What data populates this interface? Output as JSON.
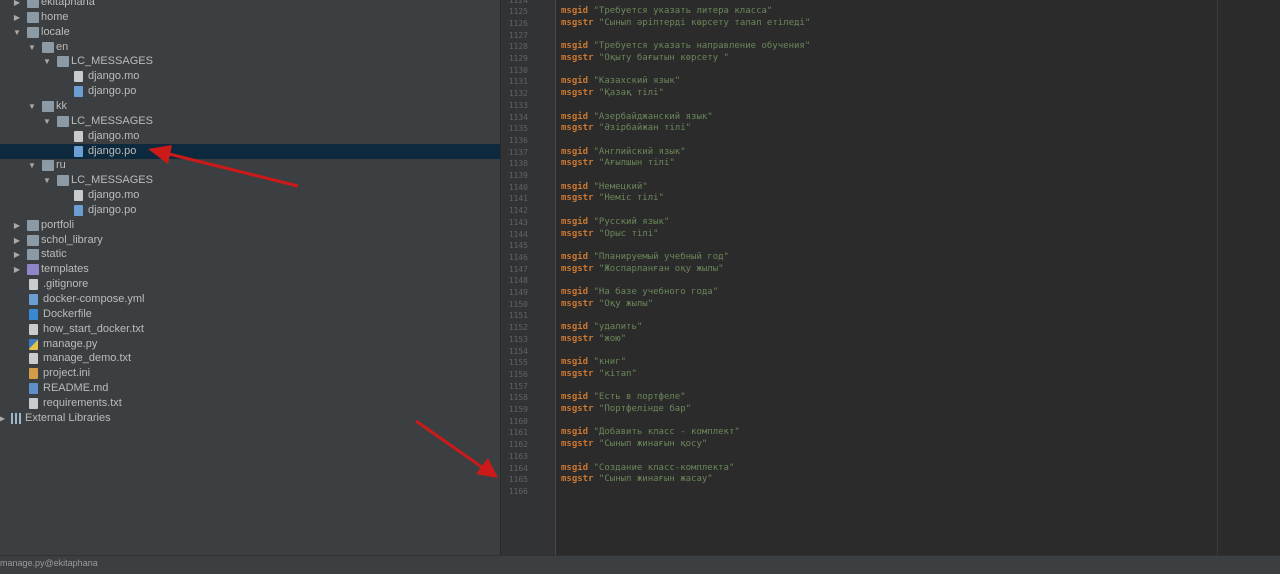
{
  "tree": [
    {
      "label": "ekitaphana",
      "type": "folder",
      "depth": 1,
      "expanded": false
    },
    {
      "label": "home",
      "type": "folder",
      "depth": 1,
      "expanded": false
    },
    {
      "label": "locale",
      "type": "folder",
      "depth": 1,
      "expanded": true
    },
    {
      "label": "en",
      "type": "folder",
      "depth": 2,
      "expanded": true
    },
    {
      "label": "LC_MESSAGES",
      "type": "folder",
      "depth": 3,
      "expanded": true
    },
    {
      "label": "django.mo",
      "type": "file",
      "ext": "mo",
      "depth": 4
    },
    {
      "label": "django.po",
      "type": "file",
      "ext": "po",
      "depth": 4
    },
    {
      "label": "kk",
      "type": "folder",
      "depth": 2,
      "expanded": true
    },
    {
      "label": "LC_MESSAGES",
      "type": "folder",
      "depth": 3,
      "expanded": true
    },
    {
      "label": "django.mo",
      "type": "file",
      "ext": "mo",
      "depth": 4
    },
    {
      "label": "django.po",
      "type": "file",
      "ext": "po",
      "depth": 4,
      "selected": true
    },
    {
      "label": "ru",
      "type": "folder",
      "depth": 2,
      "expanded": true
    },
    {
      "label": "LC_MESSAGES",
      "type": "folder",
      "depth": 3,
      "expanded": true
    },
    {
      "label": "django.mo",
      "type": "file",
      "ext": "mo",
      "depth": 4
    },
    {
      "label": "django.po",
      "type": "file",
      "ext": "po",
      "depth": 4
    },
    {
      "label": "portfoli",
      "type": "folder",
      "depth": 1,
      "expanded": false
    },
    {
      "label": "schol_library",
      "type": "folder",
      "depth": 1,
      "expanded": false
    },
    {
      "label": "static",
      "type": "folder",
      "depth": 1,
      "expanded": false
    },
    {
      "label": "templates",
      "type": "folder",
      "variant": "tpl",
      "depth": 1,
      "expanded": false
    },
    {
      "label": ".gitignore",
      "type": "file",
      "ext": "txt",
      "depth": 1
    },
    {
      "label": "docker-compose.yml",
      "type": "file",
      "ext": "po",
      "depth": 1
    },
    {
      "label": "Dockerfile",
      "type": "file",
      "ext": "dk",
      "depth": 1
    },
    {
      "label": "how_start_docker.txt",
      "type": "file",
      "ext": "txt",
      "depth": 1
    },
    {
      "label": "manage.py",
      "type": "file",
      "ext": "py",
      "depth": 1
    },
    {
      "label": "manage_demo.txt",
      "type": "file",
      "ext": "txt",
      "depth": 1
    },
    {
      "label": "project.ini",
      "type": "file",
      "ext": "ini",
      "depth": 1
    },
    {
      "label": "README.md",
      "type": "file",
      "ext": "md",
      "depth": 1
    },
    {
      "label": "requirements.txt",
      "type": "file",
      "ext": "txt",
      "depth": 1
    },
    {
      "label": "External Libraries",
      "type": "libs",
      "depth": 0,
      "expanded": false
    }
  ],
  "editor": {
    "first_line": 1124,
    "lines": [
      {},
      {
        "kw": "msgid",
        "str": " \"Требуется указать литера класса\""
      },
      {
        "kw": "msgstr",
        "str": " \"Сынып әріптерді көрсету талап етіледі\""
      },
      {},
      {
        "kw": "msgid",
        "str": " \"Требуется указать направление обучения\""
      },
      {
        "kw": "msgstr",
        "str": " \"Оқыту бағытын көрсету \""
      },
      {},
      {
        "kw": "msgid",
        "str": " \"Казахский язык\""
      },
      {
        "kw": "msgstr",
        "str": " \"Қазақ тілі\""
      },
      {},
      {
        "kw": "msgid",
        "str": " \"Азербайджанский язык\""
      },
      {
        "kw": "msgstr",
        "str": " \"Әзірбайжан тілі\""
      },
      {},
      {
        "kw": "msgid",
        "str": " \"Английский язык\""
      },
      {
        "kw": "msgstr",
        "str": " \"Ағылшын тілі\""
      },
      {},
      {
        "kw": "msgid",
        "str": " \"Немецкий\""
      },
      {
        "kw": "msgstr",
        "str": " \"Неміс тілі\""
      },
      {},
      {
        "kw": "msgid",
        "str": " \"Русский язык\""
      },
      {
        "kw": "msgstr",
        "str": " \"Орыс тілі\""
      },
      {},
      {
        "kw": "msgid",
        "str": " \"Планируемый учебный год\""
      },
      {
        "kw": "msgstr",
        "str": " \"Жоспарланған оқу жылы\""
      },
      {},
      {
        "kw": "msgid",
        "str": " \"На базе учебного года\""
      },
      {
        "kw": "msgstr",
        "str": " \"Оқу жылы\""
      },
      {},
      {
        "kw": "msgid",
        "str": " \"удалить\""
      },
      {
        "kw": "msgstr",
        "str": " \"жою\""
      },
      {},
      {
        "kw": "msgid",
        "str": " \"книг\""
      },
      {
        "kw": "msgstr",
        "str": " \"кітап\""
      },
      {},
      {
        "kw": "msgid",
        "str": " \"Есть в портфеле\""
      },
      {
        "kw": "msgstr",
        "str": " \"Портфелінде бар\""
      },
      {},
      {
        "kw": "msgid",
        "str": " \"Добавить класс - комплект\""
      },
      {
        "kw": "msgstr",
        "str": " \"Сынып жинағын қосу\""
      },
      {},
      {
        "kw": "msgid",
        "str": " \"Создание класс-комплекта\""
      },
      {
        "kw": "msgstr",
        "str": " \"Сынып жинағын жасау\""
      },
      {}
    ]
  },
  "status": {
    "text": "manage.py@ekitaphana"
  },
  "colors": {
    "keyword": "#cc7832",
    "string": "#6a8759",
    "selection": "#0d293e",
    "arrow": "#cc1a1a"
  }
}
